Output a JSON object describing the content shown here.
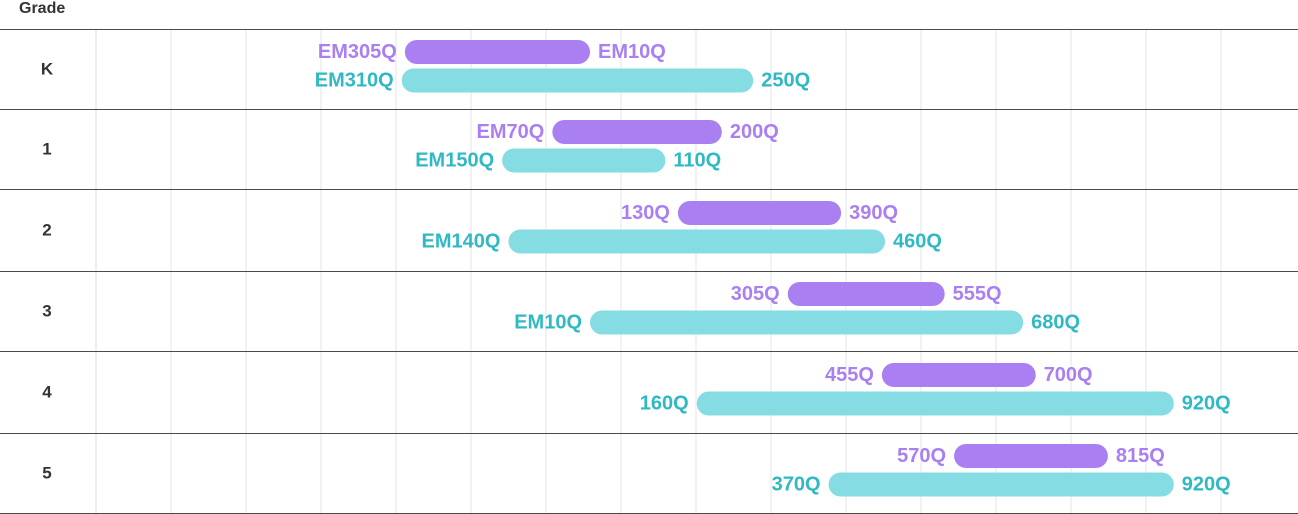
{
  "chart_data": {
    "type": "range-bar",
    "row_header": "Grade",
    "grades": [
      "K",
      "1",
      "2",
      "3",
      "4",
      "5"
    ],
    "series": [
      {
        "color": "#a97ff2",
        "ranges": [
          {
            "low": "EM305Q",
            "high": "EM10Q",
            "low_value": -305,
            "high_value": -10
          },
          {
            "low": "EM70Q",
            "high": "200Q",
            "low_value": -70,
            "high_value": 200
          },
          {
            "low": "130Q",
            "high": "390Q",
            "low_value": 130,
            "high_value": 390
          },
          {
            "low": "305Q",
            "high": "555Q",
            "low_value": 305,
            "high_value": 555
          },
          {
            "low": "455Q",
            "high": "700Q",
            "low_value": 455,
            "high_value": 700
          },
          {
            "low": "570Q",
            "high": "815Q",
            "low_value": 570,
            "high_value": 815
          }
        ]
      },
      {
        "color": "#86dce3",
        "label_color": "#2fb9c4",
        "ranges": [
          {
            "low": "EM310Q",
            "high": "250Q",
            "low_value": -310,
            "high_value": 250
          },
          {
            "low": "EM150Q",
            "high": "110Q",
            "low_value": -150,
            "high_value": 110
          },
          {
            "low": "EM140Q",
            "high": "460Q",
            "low_value": -140,
            "high_value": 460
          },
          {
            "low": "EM10Q",
            "high": "680Q",
            "low_value": -10,
            "high_value": 680
          },
          {
            "low": "160Q",
            "high": "920Q",
            "low_value": 160,
            "high_value": 920
          },
          {
            "low": "370Q",
            "high": "920Q",
            "low_value": 370,
            "high_value": 920
          }
        ]
      }
    ],
    "grid": true
  }
}
